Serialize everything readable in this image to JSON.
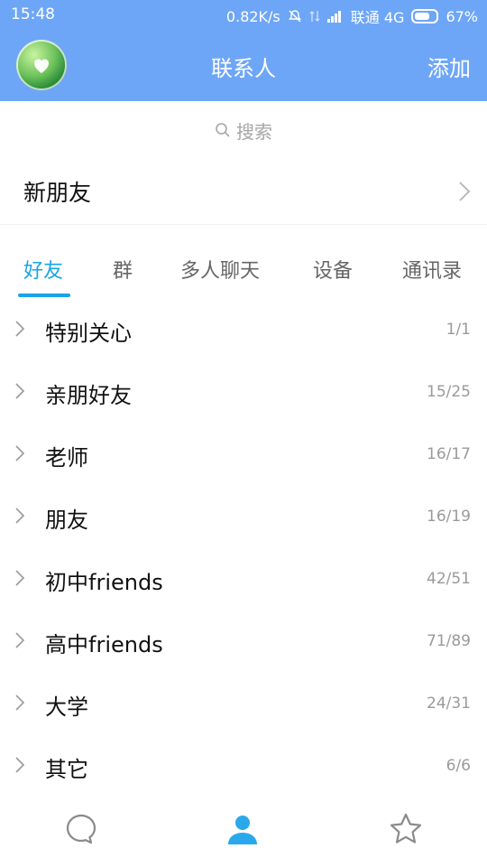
{
  "status_bar": {
    "time": "15:48",
    "speed": "0.82K/s",
    "carrier": "联通 4G",
    "battery": "67%"
  },
  "header": {
    "title": "联系人",
    "add_label": "添加"
  },
  "search": {
    "placeholder": "搜索"
  },
  "new_friends": {
    "label": "新朋友"
  },
  "tabs": [
    {
      "label": "好友",
      "active": true
    },
    {
      "label": "群"
    },
    {
      "label": "多人聊天"
    },
    {
      "label": "设备"
    },
    {
      "label": "通讯录"
    }
  ],
  "groups": [
    {
      "name": "特别关心",
      "count": "1/1"
    },
    {
      "name": "亲朋好友",
      "count": "15/25"
    },
    {
      "name": "老师",
      "count": "16/17"
    },
    {
      "name": "朋友",
      "count": "16/19"
    },
    {
      "name": "初中friends",
      "count": "42/51"
    },
    {
      "name": "高中friends",
      "count": "71/89"
    },
    {
      "name": "大学",
      "count": "24/31"
    },
    {
      "name": "其它",
      "count": "6/6"
    }
  ],
  "bottom_nav": [
    {
      "icon": "chat-bubble-icon",
      "active": false
    },
    {
      "icon": "contacts-person-icon",
      "active": true
    },
    {
      "icon": "star-icon",
      "active": false
    }
  ],
  "colors": {
    "header_bg": "#6ea6f7",
    "accent": "#1aa3e8"
  }
}
